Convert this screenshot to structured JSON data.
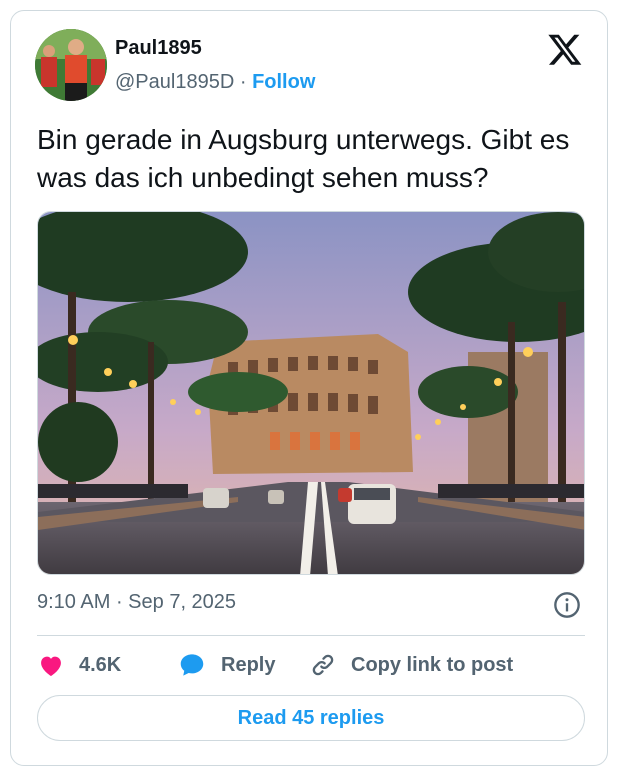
{
  "author": {
    "display_name": "Paul1895",
    "handle": "@Paul1895D",
    "separator": " · ",
    "follow_label": "Follow"
  },
  "tweet": {
    "text": "Bin gerade in Augsburg unterwegs. Gibt es was das ich unbedingt sehen muss?",
    "time": "9:10 AM",
    "separator": " · ",
    "date": "Sep 7, 2025"
  },
  "actions": {
    "like_count": "4.6K",
    "reply_label": "Reply",
    "copy_link_label": "Copy link to post"
  },
  "read_replies_label": "Read 45 replies",
  "icons": {
    "logo": "x-logo-icon",
    "like": "heart-icon",
    "reply": "speech-bubble-icon",
    "copy": "link-icon",
    "info": "info-icon"
  },
  "colors": {
    "accent": "#1d9bf0",
    "like": "#f91880",
    "muted": "#536471",
    "border": "#cfd9de"
  }
}
